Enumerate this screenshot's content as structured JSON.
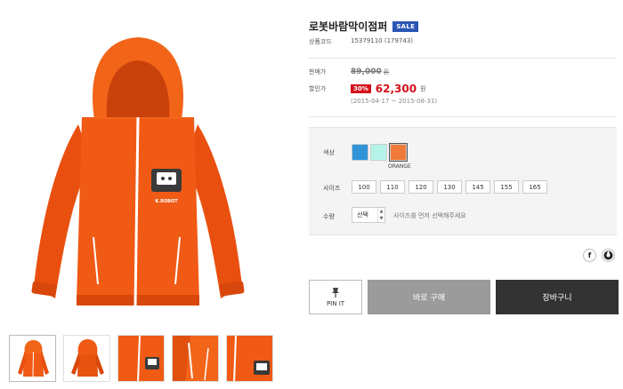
{
  "product": {
    "title": "로봇바람막이점퍼",
    "sale_badge": "SALE",
    "code_label": "상품코드",
    "code_value": "15379110 (179743)"
  },
  "price": {
    "original_label": "판매가",
    "original_value": "89,000",
    "original_unit": "원",
    "discount_label": "할인가",
    "discount_rate": "30%",
    "discount_value": "62,300",
    "discount_unit": "원",
    "period": "(2015-04-17 ~ 2015-08-31)"
  },
  "options": {
    "color_label": "색상",
    "colors": [
      {
        "name": "blue",
        "hex": "#2f93d6"
      },
      {
        "name": "mint",
        "hex": "#b5f3e8"
      },
      {
        "name": "orange",
        "hex": "#f07a3a"
      }
    ],
    "selected_color_name": "ORANGE",
    "size_label": "사이즈",
    "sizes": [
      "100",
      "110",
      "120",
      "130",
      "145",
      "155",
      "165"
    ],
    "qty_label": "수량",
    "qty_value": "선택",
    "qty_note": "사이즈를 먼저 선택해주세요"
  },
  "social": {
    "facebook_glyph": "f"
  },
  "actions": {
    "pin_label": "PIN IT",
    "buy_label": "바로 구매",
    "cart_label": "장바구니"
  },
  "jacket": {
    "badge_text": "K.ROBOT"
  },
  "colors": {
    "jacket": "#f05a14",
    "jacket_dark": "#c9410a",
    "sale_badge": "#2a56b4",
    "discount": "#d4101a"
  }
}
